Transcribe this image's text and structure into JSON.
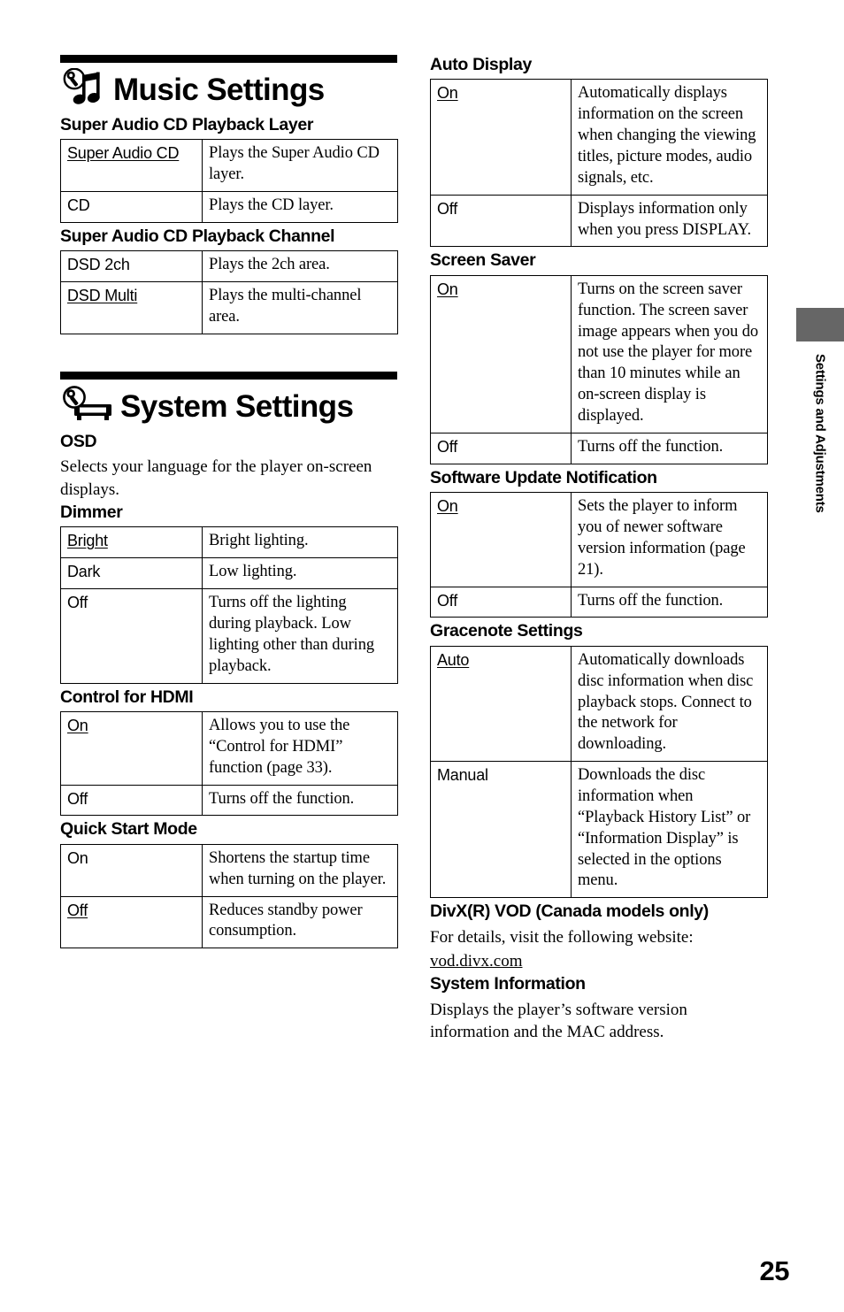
{
  "page": {
    "number": "25",
    "side_tab_label": "Settings and Adjustments"
  },
  "sections": {
    "music_settings": {
      "title": "Music Settings",
      "icon": "wrench-music-note-icon"
    },
    "system_settings": {
      "title": "System Settings",
      "icon": "wrench-player-icon"
    }
  },
  "left_column": {
    "sacd_playback_layer": {
      "heading": "Super Audio CD Playback Layer",
      "rows": [
        {
          "key": "Super Audio CD",
          "default": true,
          "value": "Plays the Super Audio CD layer."
        },
        {
          "key": "CD",
          "default": false,
          "value": "Plays the CD layer."
        }
      ]
    },
    "sacd_playback_channel": {
      "heading": "Super Audio CD Playback Channel",
      "rows": [
        {
          "key": "DSD 2ch",
          "default": false,
          "value": "Plays the 2ch area."
        },
        {
          "key": "DSD Multi",
          "default": true,
          "value": "Plays the multi-channel area."
        }
      ]
    },
    "osd": {
      "heading": "OSD",
      "body": "Selects your language for the player on-screen displays."
    },
    "dimmer": {
      "heading": "Dimmer",
      "rows": [
        {
          "key": "Bright",
          "default": true,
          "value": "Bright lighting."
        },
        {
          "key": "Dark",
          "default": false,
          "value": "Low lighting."
        },
        {
          "key": "Off",
          "default": false,
          "value": "Turns off the lighting during playback. Low lighting other than during playback."
        }
      ]
    },
    "control_for_hdmi": {
      "heading": "Control for HDMI",
      "rows": [
        {
          "key": "On",
          "default": true,
          "value": "Allows you to use the “Control for HDMI” function (page 33)."
        },
        {
          "key": "Off",
          "default": false,
          "value": "Turns off the function."
        }
      ]
    },
    "quick_start_mode": {
      "heading": "Quick Start Mode",
      "rows": [
        {
          "key": "On",
          "default": false,
          "value": "Shortens the startup time when turning on the player."
        },
        {
          "key": "Off",
          "default": true,
          "value": "Reduces standby power consumption."
        }
      ]
    }
  },
  "right_column": {
    "auto_display": {
      "heading": "Auto Display",
      "rows": [
        {
          "key": "On",
          "default": true,
          "value": "Automatically displays information on the screen when changing the viewing titles, picture modes, audio signals, etc."
        },
        {
          "key": "Off",
          "default": false,
          "value": "Displays information only when you press DISPLAY."
        }
      ]
    },
    "screen_saver": {
      "heading": "Screen Saver",
      "rows": [
        {
          "key": "On",
          "default": true,
          "value": "Turns on the screen saver function. The screen saver image appears when you do not use the player for more than 10 minutes while an on-screen display is displayed."
        },
        {
          "key": "Off",
          "default": false,
          "value": "Turns off the function."
        }
      ]
    },
    "software_update_notification": {
      "heading": "Software Update Notification",
      "rows": [
        {
          "key": "On",
          "default": true,
          "value": "Sets the player to inform you of newer software version information (page 21)."
        },
        {
          "key": "Off",
          "default": false,
          "value": "Turns off the function."
        }
      ]
    },
    "gracenote_settings": {
      "heading": "Gracenote Settings",
      "rows": [
        {
          "key": "Auto",
          "default": true,
          "value": "Automatically downloads disc information when disc playback stops. Connect to the network for downloading."
        },
        {
          "key": "Manual",
          "default": false,
          "value": "Downloads the disc information when “Playback History List” or “Information Display” is selected in the options menu."
        }
      ]
    },
    "divx_vod": {
      "heading": "DivX(R) VOD (Canada models only)",
      "body": "For details, visit the following website:",
      "link": "vod.divx.com"
    },
    "system_information": {
      "heading": "System Information",
      "body": "Displays the player’s software version information and the MAC address."
    }
  }
}
